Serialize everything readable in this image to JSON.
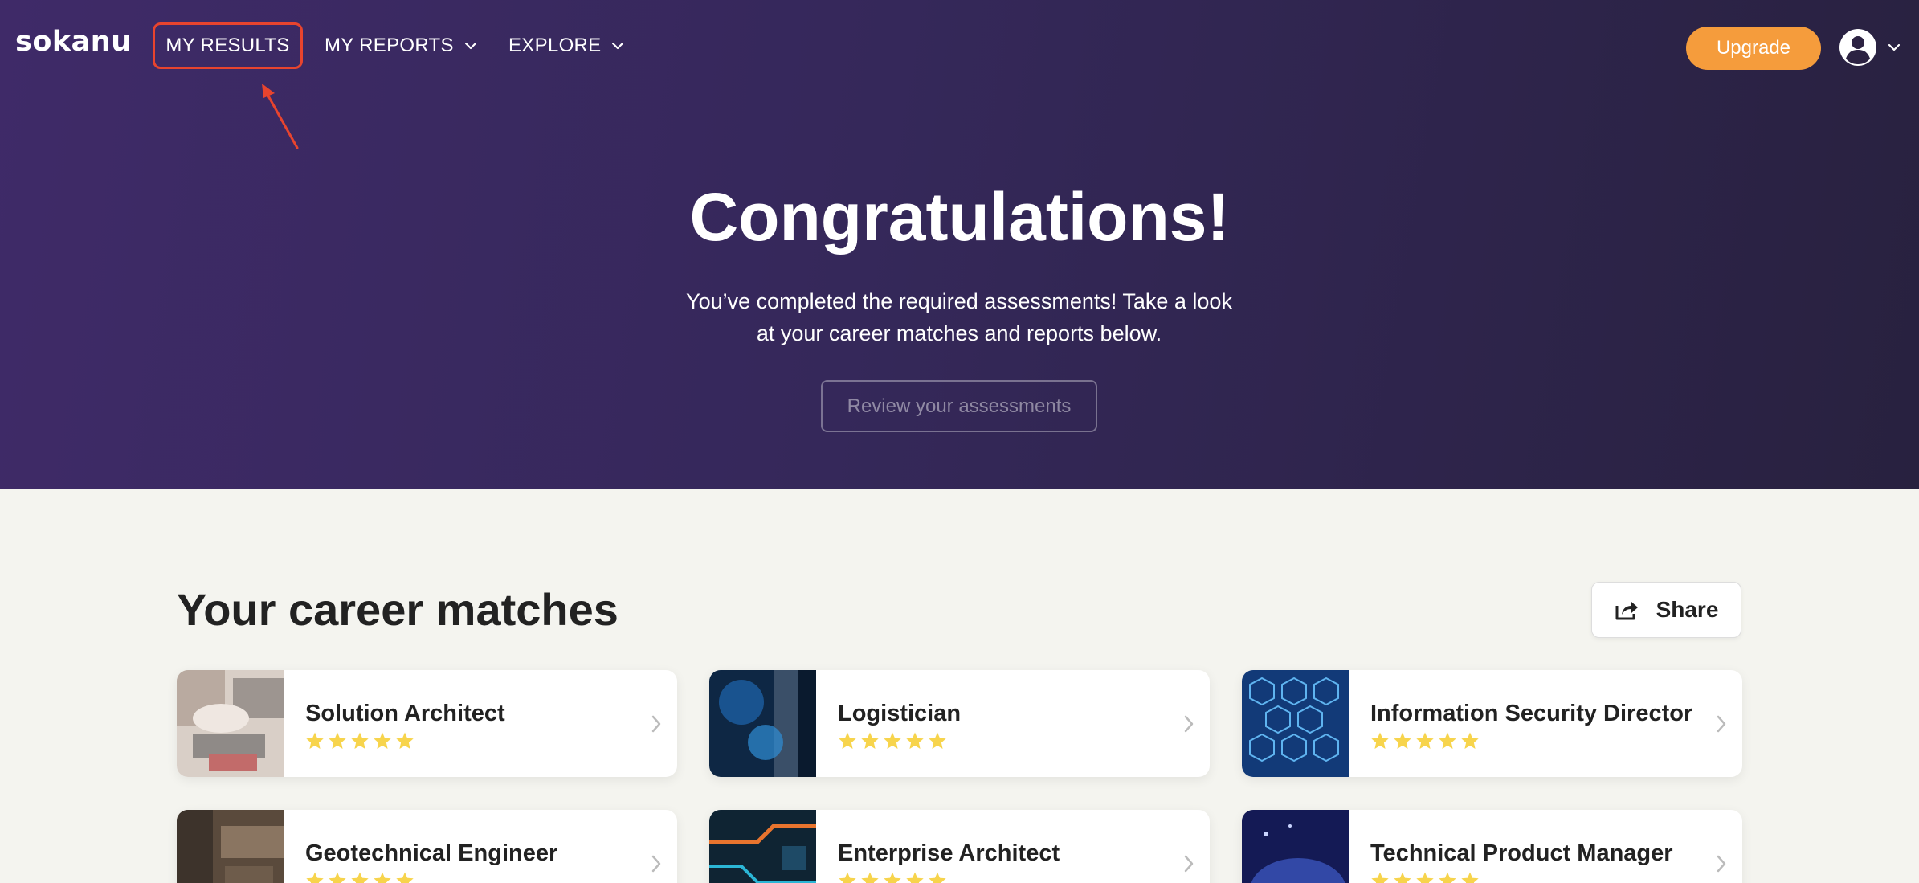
{
  "header": {
    "logo": "sokanu",
    "nav": {
      "results": "MY RESULTS",
      "reports": "MY REPORTS",
      "explore": "EXPLORE"
    },
    "upgrade_label": "Upgrade"
  },
  "hero": {
    "title": "Congratulations!",
    "subtitle": "You’ve completed the required assessments! Take a look at your career matches and reports below.",
    "review_button": "Review your assessments"
  },
  "matches": {
    "title": "Your career matches",
    "share_label": "Share",
    "cards": [
      {
        "title": "Solution Architect",
        "rating": 5
      },
      {
        "title": "Logistician",
        "rating": 5
      },
      {
        "title": "Information Security Director",
        "rating": 5
      },
      {
        "title": "Geotechnical Engineer",
        "rating": 5
      },
      {
        "title": "Enterprise Architect",
        "rating": 5
      },
      {
        "title": "Technical Product Manager",
        "rating": 5
      }
    ]
  },
  "colors": {
    "hero_bg": "#3b2a62",
    "accent_orange": "#f59c3c",
    "highlight_red": "#e8442e",
    "star_yellow": "#f7d44c",
    "page_bg": "#f4f4ef"
  }
}
